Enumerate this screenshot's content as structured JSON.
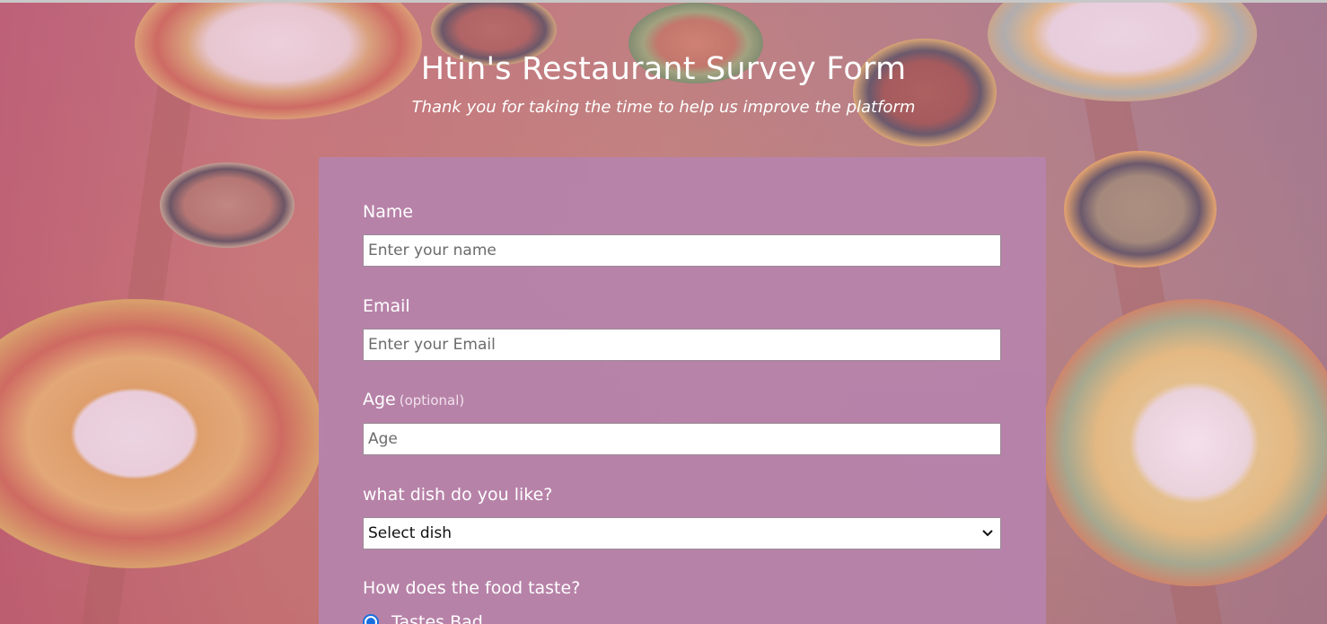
{
  "header": {
    "title": "Htin's Restaurant Survey Form",
    "subtitle": "Thank you for taking the time to help us improve the platform"
  },
  "form": {
    "name": {
      "label": "Name",
      "placeholder": "Enter your name",
      "value": ""
    },
    "email": {
      "label": "Email",
      "placeholder": "Enter your Email",
      "value": ""
    },
    "age": {
      "label": "Age",
      "optional_note": "(optional)",
      "placeholder": "Age",
      "value": ""
    },
    "dish": {
      "label": "what dish do you like?",
      "selected": "Select dish"
    },
    "taste": {
      "label": "How does the food taste?",
      "options": [
        {
          "label": "Tastes Bad",
          "checked": true
        }
      ]
    }
  },
  "colors": {
    "card": "#b783a9",
    "radio_accent": "#1a6fe0",
    "text": "#ffffff"
  }
}
